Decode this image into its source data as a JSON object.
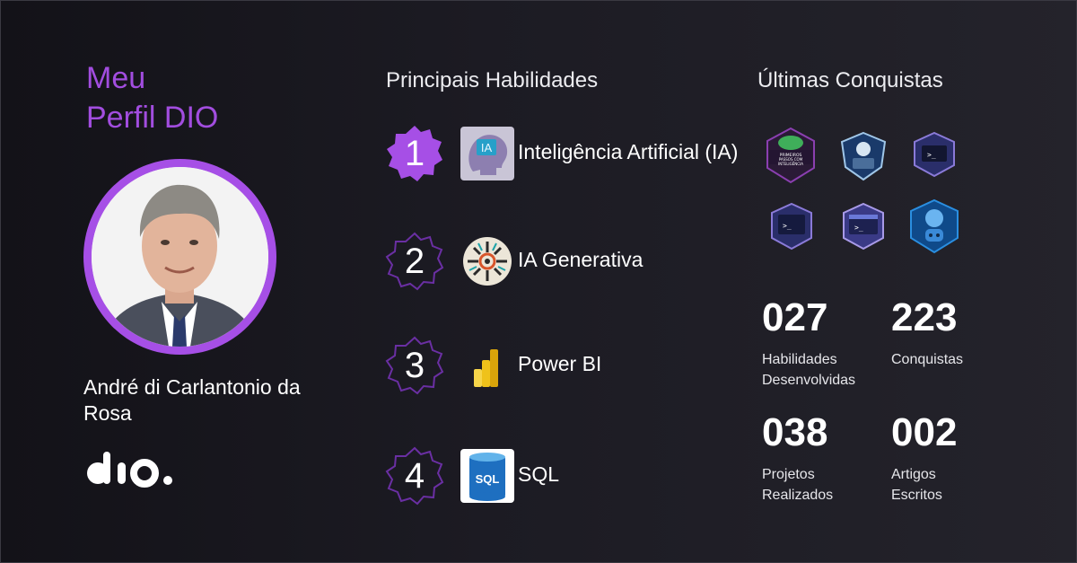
{
  "profile": {
    "title_line1": "Meu",
    "title_line2": "Perfil DIO",
    "name": "André di Carlantonio da Rosa",
    "brand": "dio."
  },
  "skills": {
    "heading": "Principais Habilidades",
    "items": [
      {
        "rank": "1",
        "name": "Inteligência Artificial (IA)",
        "logo_text": "IA",
        "highlighted": true
      },
      {
        "rank": "2",
        "name": "IA Generativa",
        "highlighted": false
      },
      {
        "rank": "3",
        "name": "Power BI",
        "highlighted": false
      },
      {
        "rank": "4",
        "name": "SQL",
        "logo_text": "SQL",
        "highlighted": false
      }
    ]
  },
  "achievements": {
    "heading": "Últimas Conquistas",
    "badges": [
      {
        "icon": "primeiros-passos-ia-badge-icon",
        "text": "PRIMEIROS PASSOS COM INTELIGÊNCIA ARTIFICIAL"
      },
      {
        "icon": "robot-laptop-badge-icon"
      },
      {
        "icon": "terminal-badge-icon"
      },
      {
        "icon": "terminal-window-badge-icon"
      },
      {
        "icon": "browser-terminal-badge-icon"
      },
      {
        "icon": "robot-brain-badge-icon"
      }
    ],
    "stats": [
      {
        "value": "027",
        "label": "Habilidades\nDesenvolvidas"
      },
      {
        "value": "223",
        "label": "Conquistas"
      },
      {
        "value": "038",
        "label": "Projetos\nRealizados"
      },
      {
        "value": "002",
        "label": "Artigos\nEscritos"
      }
    ]
  },
  "colors": {
    "accent": "#a64fe6",
    "background": "#1c1b23",
    "rank_outline": "#6a2fa3"
  }
}
